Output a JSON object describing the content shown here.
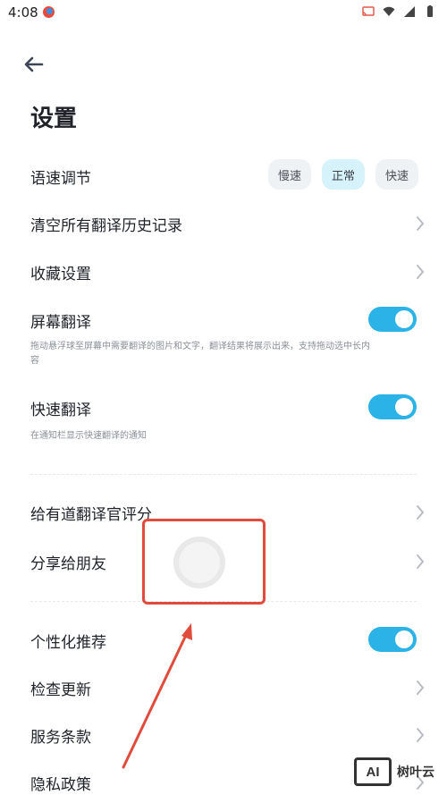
{
  "status_bar": {
    "time": "4:08"
  },
  "header": {
    "title": "设置"
  },
  "speed": {
    "label": "语速调节",
    "options": [
      "慢速",
      "正常",
      "快速"
    ],
    "selected": "正常"
  },
  "items": {
    "clear_history": "清空所有翻译历史记录",
    "favorites": "收藏设置",
    "screen_translate": {
      "label": "屏幕翻译",
      "desc": "拖动悬浮球至屏幕中需要翻译的图片和文字，翻译结果将展示出来，支持拖动选中长内容",
      "enabled": true
    },
    "quick_translate": {
      "label": "快速翻译",
      "desc": "在通知栏显示快速翻译的通知",
      "enabled": true
    },
    "rate": "给有道翻译官评分",
    "share": "分享给朋友",
    "personalized": {
      "label": "个性化推荐",
      "enabled": true
    },
    "check_update": "检查更新",
    "terms": "服务条款",
    "privacy": "隐私政策"
  },
  "watermark": {
    "logo": "AI",
    "text": "树叶云"
  },
  "colors": {
    "accent": "#2bb3e8",
    "highlight": "#e04b3c"
  }
}
